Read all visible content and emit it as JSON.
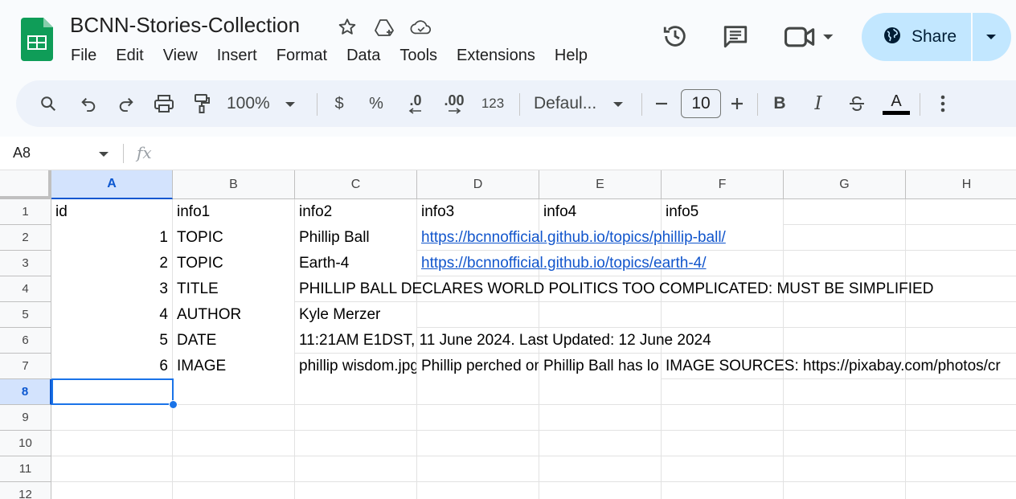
{
  "app": {
    "doc_title": "BCNN-Stories-Collection",
    "menu": [
      "File",
      "Edit",
      "View",
      "Insert",
      "Format",
      "Data",
      "Tools",
      "Extensions",
      "Help"
    ],
    "share_label": "Share"
  },
  "toolbar": {
    "zoom": "100%",
    "currency": "$",
    "percent": "%",
    "dec_decrease": ".0",
    "dec_increase": ".00",
    "format_123": "123",
    "font": "Defaul...",
    "font_size": "10",
    "bold": "B",
    "italic": "I",
    "text_color_letter": "A"
  },
  "formula_bar": {
    "name_box": "A8",
    "fx": "fx",
    "content": ""
  },
  "sheet": {
    "columns": [
      "A",
      "B",
      "C",
      "D",
      "E",
      "F",
      "G",
      "H"
    ],
    "rows": [
      "1",
      "2",
      "3",
      "4",
      "5",
      "6",
      "7",
      "8",
      "9",
      "10",
      "11",
      "12"
    ],
    "selected_cell": "A8",
    "cells": {
      "A1": "id",
      "B1": "info1",
      "C1": "info2",
      "D1": "info3",
      "E1": "info4",
      "F1": "info5",
      "A2": "1",
      "B2": "TOPIC",
      "C2": "Phillip Ball",
      "D2": "https://bcnnofficial.github.io/topics/phillip-ball/",
      "A3": "2",
      "B3": "TOPIC",
      "C3": "Earth-4",
      "D3": "https://bcnnofficial.github.io/topics/earth-4/",
      "A4": "3",
      "B4": "TITLE",
      "C4": "PHILLIP BALL DECLARES WORLD POLITICS TOO COMPLICATED: MUST BE SIMPLIFIED",
      "A5": "4",
      "B5": "AUTHOR",
      "C5": "Kyle Merzer",
      "A6": "5",
      "B6": "DATE",
      "C6": "11:21AM E1DST, 11 June 2024. Last Updated: 12 June 2024",
      "A7": "6",
      "B7": "IMAGE",
      "C7": "phillip wisdom.jpg",
      "D7": "Phillip perched on",
      "E7": "Phillip Ball has lo",
      "F7": "IMAGE SOURCES: https://pixabay.com/photos/cr"
    }
  },
  "colors": {
    "accent": "#0b57d0",
    "share_bg": "#c2e7ff",
    "link": "#1155cc",
    "logo_green": "#0f9d58"
  }
}
